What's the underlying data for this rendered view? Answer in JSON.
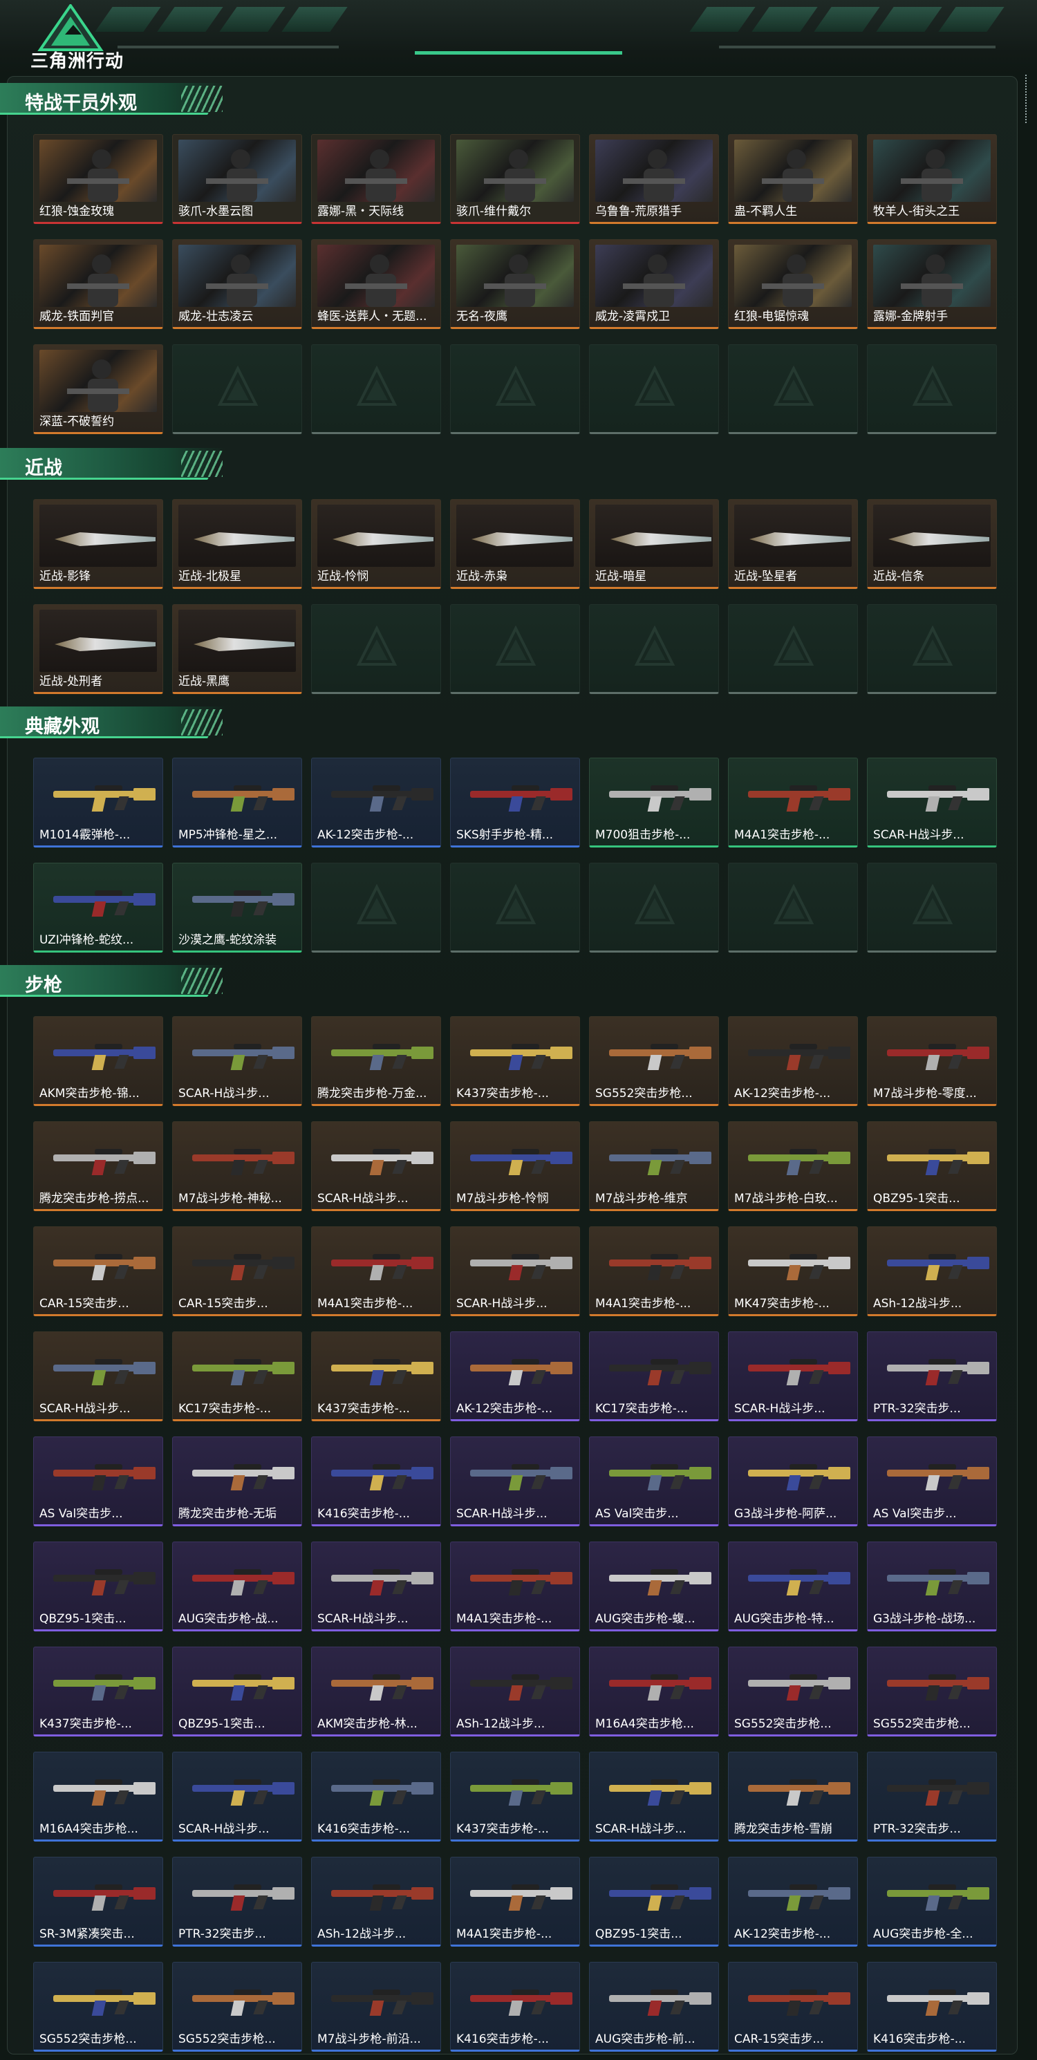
{
  "header": {
    "game_title": "三角洲行动",
    "logo_icon": "delta-triangle-logo-icon"
  },
  "sections": [
    {
      "title": "特战干员外观",
      "items": [
        {
          "label": "红狼-蚀金玫瑰",
          "rarity": "red"
        },
        {
          "label": "骇爪-水墨云图",
          "rarity": "red"
        },
        {
          "label": "露娜-黑・天际线",
          "rarity": "red"
        },
        {
          "label": "骇爪-维什戴尔",
          "rarity": "red"
        },
        {
          "label": "乌鲁鲁-荒原猎手",
          "rarity": "orange"
        },
        {
          "label": "蛊-不羁人生",
          "rarity": "orange"
        },
        {
          "label": "牧羊人-街头之王",
          "rarity": "orange"
        },
        {
          "label": "威龙-铁面判官",
          "rarity": "orange"
        },
        {
          "label": "威龙-壮志凌云",
          "rarity": "orange"
        },
        {
          "label": "蜂医-送葬人・无题...",
          "rarity": "orange"
        },
        {
          "label": "无名-夜鹰",
          "rarity": "orange"
        },
        {
          "label": "威龙-凌霄戍卫",
          "rarity": "orange"
        },
        {
          "label": "红狼-电锯惊魂",
          "rarity": "orange"
        },
        {
          "label": "露娜-金牌射手",
          "rarity": "orange"
        },
        {
          "label": "深蓝-不破誓约",
          "rarity": "orange"
        }
      ],
      "empty_slots": 6
    },
    {
      "title": "近战",
      "items": [
        {
          "label": "近战-影锋",
          "rarity": "orange"
        },
        {
          "label": "近战-北极星",
          "rarity": "orange"
        },
        {
          "label": "近战-怜悯",
          "rarity": "orange"
        },
        {
          "label": "近战-赤枭",
          "rarity": "orange"
        },
        {
          "label": "近战-暗星",
          "rarity": "orange"
        },
        {
          "label": "近战-坠星者",
          "rarity": "orange"
        },
        {
          "label": "近战-信条",
          "rarity": "orange"
        },
        {
          "label": "近战-处刑者",
          "rarity": "orange"
        },
        {
          "label": "近战-黑鹰",
          "rarity": "orange"
        }
      ],
      "empty_slots": 5
    },
    {
      "title": "典藏外观",
      "items": [
        {
          "label": "M1014霰弹枪-...",
          "rarity": "blue"
        },
        {
          "label": "MP5冲锋枪-星之...",
          "rarity": "blue"
        },
        {
          "label": "AK-12突击步枪-...",
          "rarity": "blue"
        },
        {
          "label": "SKS射手步枪-精...",
          "rarity": "blue"
        },
        {
          "label": "M700狙击步枪-...",
          "rarity": "green"
        },
        {
          "label": "M4A1突击步枪-...",
          "rarity": "green"
        },
        {
          "label": "SCAR-H战斗步...",
          "rarity": "green"
        },
        {
          "label": "UZI冲锋枪-蛇纹...",
          "rarity": "green"
        },
        {
          "label": "沙漠之鹰-蛇纹涂装",
          "rarity": "green"
        }
      ],
      "empty_slots": 5
    },
    {
      "title": "步枪",
      "items": [
        {
          "label": "AKM突击步枪-锦...",
          "rarity": "orange"
        },
        {
          "label": "SCAR-H战斗步...",
          "rarity": "orange"
        },
        {
          "label": "腾龙突击步枪-万金...",
          "rarity": "orange"
        },
        {
          "label": "K437突击步枪-...",
          "rarity": "orange"
        },
        {
          "label": "SG552突击步枪...",
          "rarity": "orange"
        },
        {
          "label": "AK-12突击步枪-...",
          "rarity": "orange"
        },
        {
          "label": "M7战斗步枪-零度...",
          "rarity": "orange"
        },
        {
          "label": "腾龙突击步枪-捞点...",
          "rarity": "orange"
        },
        {
          "label": "M7战斗步枪-神秘...",
          "rarity": "orange"
        },
        {
          "label": "SCAR-H战斗步...",
          "rarity": "orange"
        },
        {
          "label": "M7战斗步枪-怜悯",
          "rarity": "orange"
        },
        {
          "label": "M7战斗步枪-维京",
          "rarity": "orange"
        },
        {
          "label": "M7战斗步枪-白玫...",
          "rarity": "orange"
        },
        {
          "label": "QBZ95-1突击...",
          "rarity": "orange"
        },
        {
          "label": "CAR-15突击步...",
          "rarity": "orange"
        },
        {
          "label": "CAR-15突击步...",
          "rarity": "orange"
        },
        {
          "label": "M4A1突击步枪-...",
          "rarity": "orange"
        },
        {
          "label": "SCAR-H战斗步...",
          "rarity": "orange"
        },
        {
          "label": "M4A1突击步枪-...",
          "rarity": "orange"
        },
        {
          "label": "MK47突击步枪-...",
          "rarity": "orange"
        },
        {
          "label": "ASh-12战斗步...",
          "rarity": "orange"
        },
        {
          "label": "SCAR-H战斗步...",
          "rarity": "orange"
        },
        {
          "label": "KC17突击步枪-...",
          "rarity": "orange"
        },
        {
          "label": "K437突击步枪-...",
          "rarity": "orange"
        },
        {
          "label": "AK-12突击步枪-...",
          "rarity": "purple"
        },
        {
          "label": "KC17突击步枪-...",
          "rarity": "purple"
        },
        {
          "label": "SCAR-H战斗步...",
          "rarity": "purple"
        },
        {
          "label": "PTR-32突击步...",
          "rarity": "purple"
        },
        {
          "label": "AS Val突击步...",
          "rarity": "purple"
        },
        {
          "label": "腾龙突击步枪-无垢",
          "rarity": "purple"
        },
        {
          "label": "K416突击步枪-...",
          "rarity": "purple"
        },
        {
          "label": "SCAR-H战斗步...",
          "rarity": "purple"
        },
        {
          "label": "AS Val突击步...",
          "rarity": "purple"
        },
        {
          "label": "G3战斗步枪-阿萨...",
          "rarity": "purple"
        },
        {
          "label": "AS Val突击步...",
          "rarity": "purple"
        },
        {
          "label": "QBZ95-1突击...",
          "rarity": "purple"
        },
        {
          "label": "AUG突击步枪-战...",
          "rarity": "purple"
        },
        {
          "label": "SCAR-H战斗步...",
          "rarity": "purple"
        },
        {
          "label": "M4A1突击步枪-...",
          "rarity": "purple"
        },
        {
          "label": "AUG突击步枪-蝮...",
          "rarity": "purple"
        },
        {
          "label": "AUG突击步枪-特...",
          "rarity": "purple"
        },
        {
          "label": "G3战斗步枪-战场...",
          "rarity": "purple"
        },
        {
          "label": "K437突击步枪-...",
          "rarity": "purple"
        },
        {
          "label": "QBZ95-1突击...",
          "rarity": "purple"
        },
        {
          "label": "AKM突击步枪-林...",
          "rarity": "purple"
        },
        {
          "label": "ASh-12战斗步...",
          "rarity": "purple"
        },
        {
          "label": "M16A4突击步枪...",
          "rarity": "purple"
        },
        {
          "label": "SG552突击步枪...",
          "rarity": "purple"
        },
        {
          "label": "SG552突击步枪...",
          "rarity": "purple"
        },
        {
          "label": "M16A4突击步枪...",
          "rarity": "blue"
        },
        {
          "label": "SCAR-H战斗步...",
          "rarity": "blue"
        },
        {
          "label": "K416突击步枪-...",
          "rarity": "blue"
        },
        {
          "label": "K437突击步枪-...",
          "rarity": "blue"
        },
        {
          "label": "SCAR-H战斗步...",
          "rarity": "blue"
        },
        {
          "label": "腾龙突击步枪-雪崩",
          "rarity": "blue"
        },
        {
          "label": "PTR-32突击步...",
          "rarity": "blue"
        },
        {
          "label": "SR-3M紧凑突击...",
          "rarity": "blue"
        },
        {
          "label": "PTR-32突击步...",
          "rarity": "blue"
        },
        {
          "label": "ASh-12战斗步...",
          "rarity": "blue"
        },
        {
          "label": "M4A1突击步枪-...",
          "rarity": "blue"
        },
        {
          "label": "QBZ95-1突击...",
          "rarity": "blue"
        },
        {
          "label": "AK-12突击步枪-...",
          "rarity": "blue"
        },
        {
          "label": "AUG突击步枪-全...",
          "rarity": "blue"
        },
        {
          "label": "SG552突击步枪...",
          "rarity": "blue"
        },
        {
          "label": "SG552突击步枪...",
          "rarity": "blue"
        },
        {
          "label": "M7战斗步枪-前沿...",
          "rarity": "blue"
        },
        {
          "label": "K416突击步枪-...",
          "rarity": "blue"
        },
        {
          "label": "AUG突击步枪-前...",
          "rarity": "blue"
        },
        {
          "label": "CAR-15突击步...",
          "rarity": "blue"
        },
        {
          "label": "K416突击步枪-...",
          "rarity": "blue"
        }
      ],
      "empty_slots": 0
    }
  ],
  "colors": {
    "accent": "#39c98a",
    "orange": "#d27a2c",
    "red": "#c83434",
    "blue": "#3f73d8",
    "green": "#36c47d",
    "purple": "#7f5ee0"
  }
}
